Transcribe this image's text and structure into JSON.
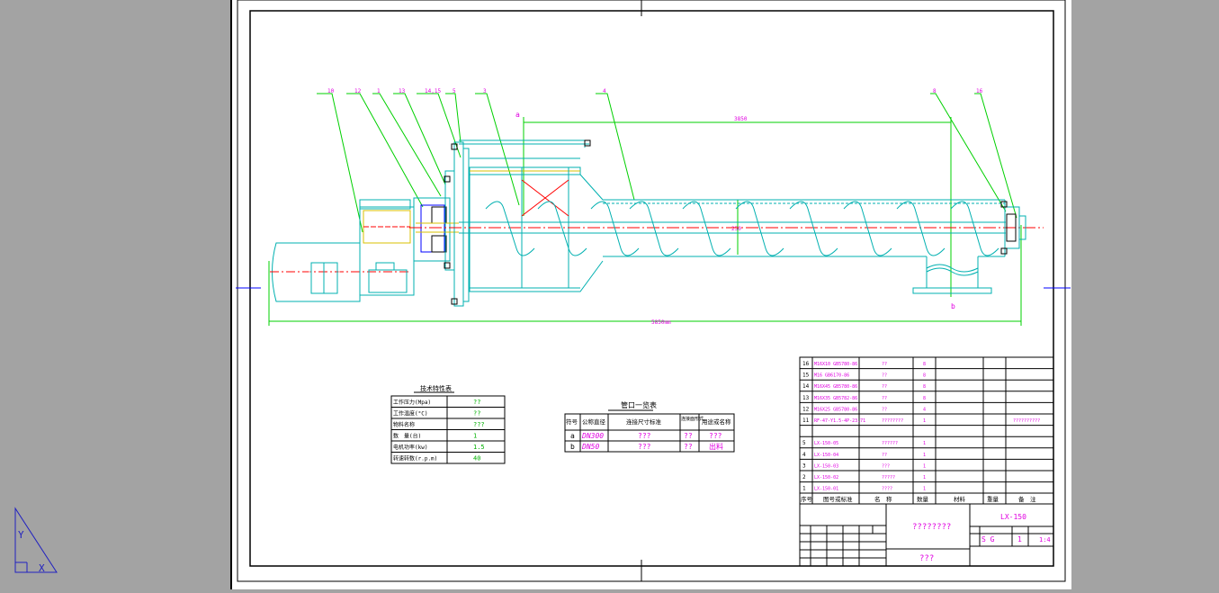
{
  "colors": {
    "background": "#a3a3a3",
    "paper": "#ffffff",
    "frame": "#000000",
    "leader": "#00d000",
    "outline": "#00b0b0",
    "magenta": "#e000e0",
    "red": "#ff0000",
    "yellow": "#d8c000",
    "blue": "#0000ff",
    "ucs": "#2020c0"
  },
  "drawing": {
    "view": "elevation",
    "callout_labels": [
      "10",
      "12",
      "1",
      "13",
      "14,15",
      "5",
      "3",
      "4",
      "8",
      "16"
    ],
    "dim_total_length": "5850mm",
    "dim_inlet_to_outlet": "3850",
    "dim_pitch_label": "250",
    "inlet_tag": "a",
    "outlet_tag": "b"
  },
  "tech_table": {
    "title": "技术特性表",
    "rows": [
      {
        "label": "工作压力(Mpa)",
        "value": "??"
      },
      {
        "label": "工作温度(°C)",
        "value": "??"
      },
      {
        "label": "物料名称",
        "value": "???"
      },
      {
        "label": "数　量(台)",
        "value": "1"
      },
      {
        "label": "电机功率(kw)",
        "value": "1.5"
      },
      {
        "label": "转速转数(r.p.m)",
        "value": "40"
      }
    ]
  },
  "nozzle_table": {
    "title": "管口一览表",
    "headers": [
      "符号",
      "公称直径",
      "连接尺寸标准",
      "连接面形式",
      "用途或名称"
    ],
    "rows": [
      {
        "mark": "a",
        "dn": "DN300",
        "std": "???",
        "face": "??",
        "use": "???"
      },
      {
        "mark": "b",
        "dn": "DN50",
        "std": "???",
        "face": "??",
        "use": "出料"
      }
    ]
  },
  "bom": {
    "rows": [
      {
        "no": "16",
        "code": "M16X10 GB5780-86",
        "name": "??",
        "qty": "8"
      },
      {
        "no": "15",
        "code": "M16 GB6170-86",
        "name": "??",
        "qty": "8"
      },
      {
        "no": "14",
        "code": "M16X45 GB5780-86",
        "name": "??",
        "qty": "8"
      },
      {
        "no": "13",
        "code": "M16X35 GB5782-86",
        "name": "??",
        "qty": "8"
      },
      {
        "no": "12",
        "code": "M16X25 GB5780-86",
        "name": "??",
        "qty": "4"
      },
      {
        "no": "11",
        "code": "RF-47-Y1.5-4P-23.71",
        "name": "????????",
        "qty": "1",
        "note": "??????????"
      },
      {
        "no": "",
        "code": "",
        "name": "",
        "qty": ""
      },
      {
        "no": "5",
        "code": "LX-150-05",
        "name": "??????",
        "qty": "1"
      },
      {
        "no": "4",
        "code": "LX-150-04",
        "name": "??",
        "qty": "1"
      },
      {
        "no": "3",
        "code": "LX-150-03",
        "name": "???",
        "qty": "1"
      },
      {
        "no": "2",
        "code": "LX-150-02",
        "name": "?????",
        "qty": "1"
      },
      {
        "no": "1",
        "code": "LX-150-01",
        "name": "????",
        "qty": "1"
      }
    ],
    "header": [
      "序号",
      "图号或标准",
      "名　称",
      "数量",
      "材料",
      "重量",
      "备　注"
    ]
  },
  "title_block": {
    "drawing_no": "LX-150",
    "center_title": "????????",
    "company": "???",
    "scale": "1:4",
    "stage": "S G",
    "sheet": "1"
  }
}
